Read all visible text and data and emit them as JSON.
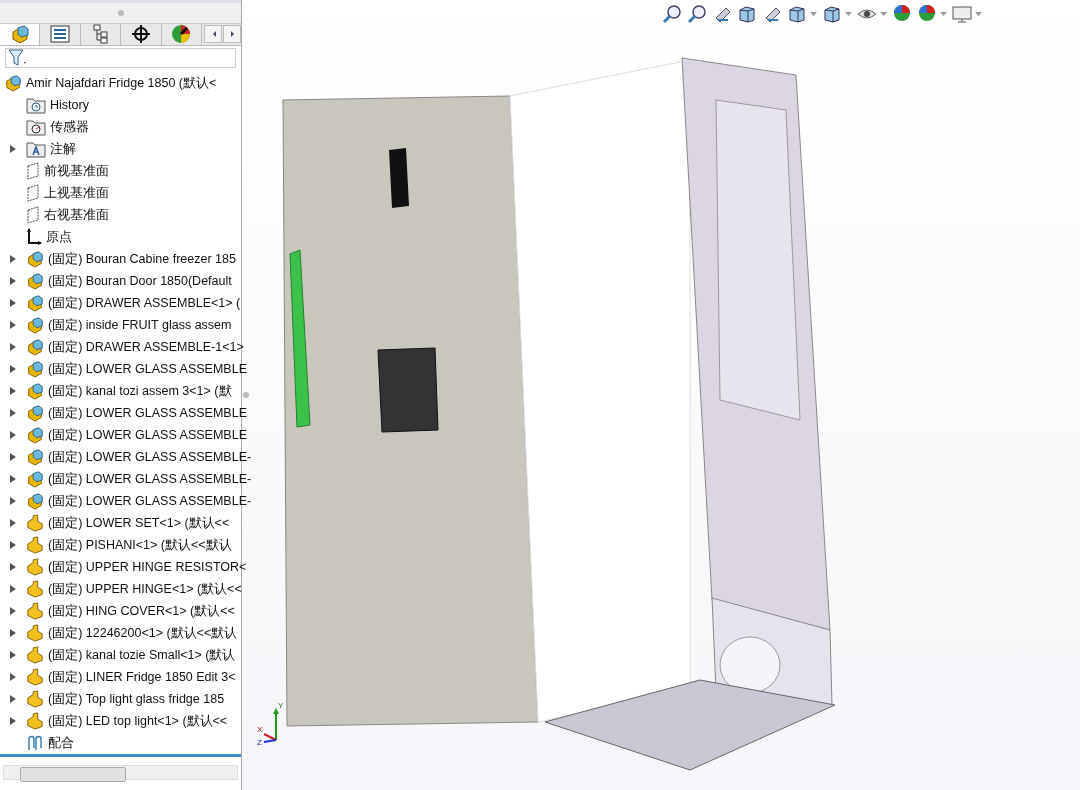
{
  "panel": {
    "tabs": [
      {
        "kind": "feature",
        "selected": true
      },
      {
        "kind": "property",
        "selected": false
      },
      {
        "kind": "config",
        "selected": false
      },
      {
        "kind": "dim",
        "selected": false
      },
      {
        "kind": "appearance",
        "selected": false
      }
    ],
    "tree": {
      "root": {
        "kind": "assembly",
        "label": "Amir Najafdari Fridge 1850  (默认<"
      },
      "items": [
        {
          "kind": "history",
          "label": "History"
        },
        {
          "kind": "sensor",
          "label": "传感器"
        },
        {
          "kind": "annotation",
          "label": "注解",
          "expanded": false
        },
        {
          "kind": "plane",
          "label": "前视基准面"
        },
        {
          "kind": "plane",
          "label": "上视基准面"
        },
        {
          "kind": "plane",
          "label": "右视基准面"
        },
        {
          "kind": "origin",
          "label": "原点"
        },
        {
          "kind": "assembly",
          "label": "(固定) Bouran Cabine freezer 185",
          "expanded": false
        },
        {
          "kind": "assembly",
          "label": "(固定) Bouran Door 1850(Default",
          "expanded": false
        },
        {
          "kind": "assembly",
          "label": "(固定) DRAWER ASSEMBLE<1> (",
          "expanded": false
        },
        {
          "kind": "assembly",
          "label": "(固定) inside  FRUIT glass assem",
          "expanded": false
        },
        {
          "kind": "assembly",
          "label": "(固定) DRAWER ASSEMBLE-1<1>",
          "expanded": false
        },
        {
          "kind": "assembly",
          "label": "(固定) LOWER GLASS ASSEMBLE",
          "expanded": false
        },
        {
          "kind": "assembly",
          "label": "(固定) kanal tozi assem 3<1> (默",
          "expanded": false
        },
        {
          "kind": "assembly",
          "label": "(固定) LOWER GLASS ASSEMBLE",
          "expanded": false
        },
        {
          "kind": "assembly",
          "label": "(固定) LOWER GLASS ASSEMBLE",
          "expanded": false
        },
        {
          "kind": "assembly",
          "label": "(固定) LOWER GLASS ASSEMBLE-",
          "expanded": false
        },
        {
          "kind": "assembly",
          "label": "(固定) LOWER GLASS ASSEMBLE-",
          "expanded": false
        },
        {
          "kind": "assembly",
          "label": "(固定) LOWER GLASS ASSEMBLE-",
          "expanded": false
        },
        {
          "kind": "part",
          "label": "(固定) LOWER SET<1> (默认<<",
          "expanded": false
        },
        {
          "kind": "part",
          "label": "(固定) PISHANI<1> (默认<<默认",
          "expanded": false
        },
        {
          "kind": "part",
          "label": "(固定) UPPER HINGE RESISTOR<",
          "expanded": false
        },
        {
          "kind": "part",
          "label": "(固定) UPPER HINGE<1> (默认<<",
          "expanded": false
        },
        {
          "kind": "part",
          "label": "(固定) HING COVER<1> (默认<<",
          "expanded": false
        },
        {
          "kind": "part",
          "label": "(固定) 12246200<1> (默认<<默认",
          "expanded": false
        },
        {
          "kind": "part",
          "label": "(固定) kanal tozie Small<1> (默认",
          "expanded": false
        },
        {
          "kind": "part",
          "label": "(固定) LINER Fridge 1850 Edit 3<",
          "expanded": false
        },
        {
          "kind": "part",
          "label": "(固定) Top light glass fridge 185",
          "expanded": false
        },
        {
          "kind": "part",
          "label": "(固定) LED top light<1> (默认<<",
          "expanded": false
        },
        {
          "kind": "mates",
          "label": "配合"
        }
      ]
    }
  },
  "toolbar": [
    {
      "kind": "zoom-fit",
      "dropdown": false
    },
    {
      "kind": "zoom-area",
      "dropdown": false
    },
    {
      "kind": "previous-view",
      "dropdown": false
    },
    {
      "kind": "section",
      "dropdown": false
    },
    {
      "kind": "dynamic",
      "dropdown": false
    },
    {
      "kind": "orientation",
      "dropdown": true
    },
    {
      "kind": "display-style",
      "dropdown": true
    },
    {
      "kind": "hide-show",
      "dropdown": true
    },
    {
      "kind": "edit-appearance",
      "dropdown": false
    },
    {
      "kind": "scene",
      "dropdown": true
    },
    {
      "kind": "display",
      "dropdown": true
    }
  ],
  "triad": {
    "x": "X",
    "y": "Y",
    "z": "Z"
  }
}
